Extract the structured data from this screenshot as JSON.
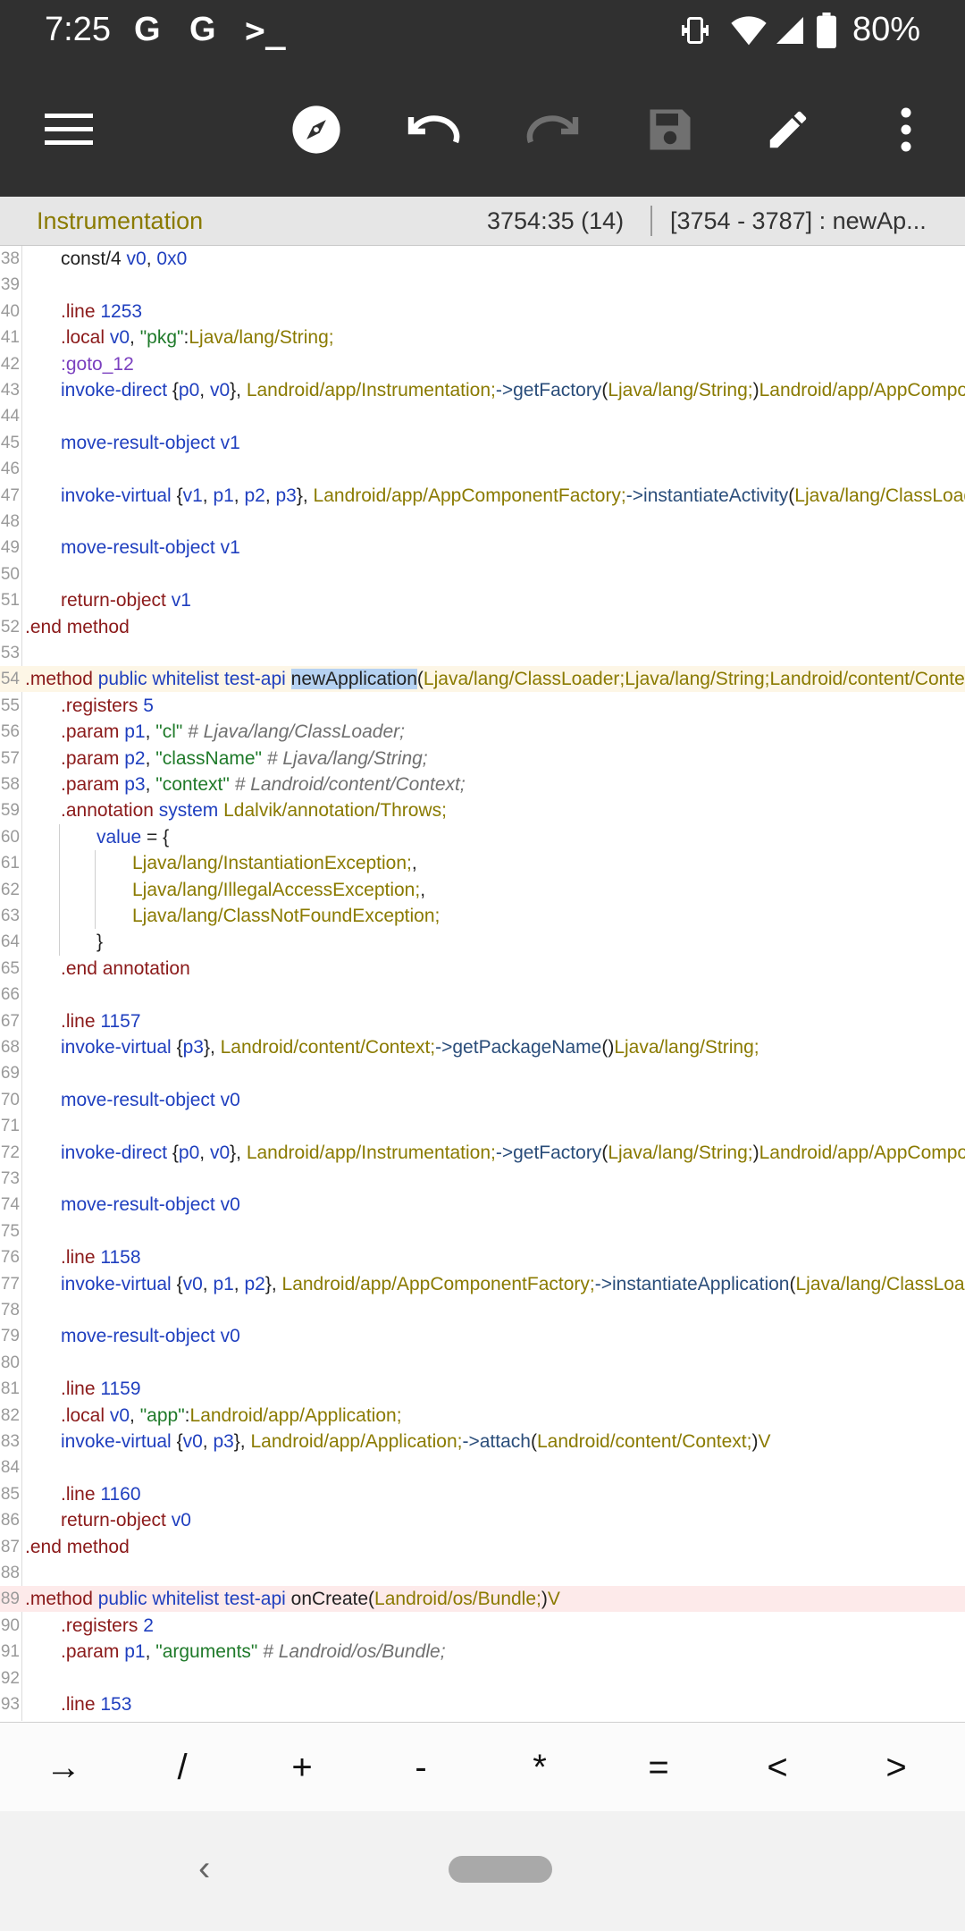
{
  "status_bar": {
    "time": "7:25",
    "notif_icons": [
      "G",
      "G",
      ">_"
    ],
    "battery": "80%"
  },
  "toolbar": {
    "buttons": [
      "menu-icon",
      "compass-icon",
      "undo-icon",
      "redo-icon",
      "save-icon",
      "edit-icon",
      "more-icon"
    ]
  },
  "info_bar": {
    "class_name": "Instrumentation",
    "position": "3754:35 (14)",
    "range": "[3754 - 3787] : newAp..."
  },
  "editor": {
    "lines": [
      {
        "n": "38",
        "tokens": [
          [
            "pl",
            "const/4 "
          ],
          [
            "reg",
            "v0"
          ],
          [
            "pl",
            ", "
          ],
          [
            "reg",
            "0x0"
          ]
        ]
      },
      {
        "n": "39",
        "tokens": []
      },
      {
        "n": "40",
        "tokens": [
          [
            "kw",
            ".line "
          ],
          [
            "reg",
            "1253"
          ]
        ]
      },
      {
        "n": "41",
        "tokens": [
          [
            "kw",
            ".local "
          ],
          [
            "reg",
            "v0"
          ],
          [
            "pl",
            ", "
          ],
          [
            "str",
            "\"pkg\""
          ],
          [
            "pl",
            ":"
          ],
          [
            "cls",
            "Ljava/lang/String;"
          ]
        ]
      },
      {
        "n": "42",
        "tokens": [
          [
            "lbl",
            ":goto_12"
          ]
        ]
      },
      {
        "n": "43",
        "tokens": [
          [
            "reg",
            "invoke-direct "
          ],
          [
            "pl",
            "{"
          ],
          [
            "reg",
            "p0"
          ],
          [
            "pl",
            ", "
          ],
          [
            "reg",
            "v0"
          ],
          [
            "pl",
            "}, "
          ],
          [
            "cls",
            "Landroid/app/Instrumentation;"
          ],
          [
            "meth",
            "->getFactory"
          ],
          [
            "pl",
            "("
          ],
          [
            "cls",
            "Ljava/lang/String;"
          ],
          [
            "pl",
            ")"
          ],
          [
            "cls",
            "Landroid/app/AppComponentFactory;"
          ]
        ]
      },
      {
        "n": "44",
        "tokens": []
      },
      {
        "n": "45",
        "tokens": [
          [
            "reg",
            "move-result-object "
          ],
          [
            "reg",
            "v1"
          ]
        ]
      },
      {
        "n": "46",
        "tokens": []
      },
      {
        "n": "47",
        "tokens": [
          [
            "reg",
            "invoke-virtual "
          ],
          [
            "pl",
            "{"
          ],
          [
            "reg",
            "v1"
          ],
          [
            "pl",
            ", "
          ],
          [
            "reg",
            "p1"
          ],
          [
            "pl",
            ", "
          ],
          [
            "reg",
            "p2"
          ],
          [
            "pl",
            ", "
          ],
          [
            "reg",
            "p3"
          ],
          [
            "pl",
            "}, "
          ],
          [
            "cls",
            "Landroid/app/AppComponentFactory;"
          ],
          [
            "meth",
            "->instantiateActivity"
          ],
          [
            "pl",
            "("
          ],
          [
            "cls",
            "Ljava/lang/ClassLoader;"
          ]
        ]
      },
      {
        "n": "48",
        "tokens": []
      },
      {
        "n": "49",
        "tokens": [
          [
            "reg",
            "move-result-object "
          ],
          [
            "reg",
            "v1"
          ]
        ]
      },
      {
        "n": "50",
        "tokens": []
      },
      {
        "n": "51",
        "tokens": [
          [
            "kw",
            "return-object "
          ],
          [
            "reg",
            "v1"
          ]
        ]
      },
      {
        "n": "52",
        "tokens": [
          [
            "kw",
            ".end method"
          ]
        ]
      },
      {
        "n": "53",
        "tokens": []
      },
      {
        "n": "54",
        "tokens": [
          [
            "kw",
            ".method "
          ],
          [
            "reg",
            "public whitelist test-api "
          ],
          [
            "sel",
            "newApplication"
          ],
          [
            "pl",
            "("
          ],
          [
            "cls",
            "Ljava/lang/ClassLoader;Ljava/lang/String;Landroid/content/Context;"
          ]
        ]
      },
      {
        "n": "55",
        "tokens": [
          [
            "kw",
            ".registers "
          ],
          [
            "reg",
            "5"
          ]
        ]
      },
      {
        "n": "56",
        "tokens": [
          [
            "kw",
            ".param "
          ],
          [
            "reg",
            "p1"
          ],
          [
            "pl",
            ", "
          ],
          [
            "str",
            "\"cl\""
          ],
          [
            "cmt",
            "   # Ljava/lang/ClassLoader;"
          ]
        ]
      },
      {
        "n": "57",
        "tokens": [
          [
            "kw",
            ".param "
          ],
          [
            "reg",
            "p2"
          ],
          [
            "pl",
            ", "
          ],
          [
            "str",
            "\"className\""
          ],
          [
            "cmt",
            "   # Ljava/lang/String;"
          ]
        ]
      },
      {
        "n": "58",
        "tokens": [
          [
            "kw",
            ".param "
          ],
          [
            "reg",
            "p3"
          ],
          [
            "pl",
            ", "
          ],
          [
            "str",
            "\"context\""
          ],
          [
            "cmt",
            "   # Landroid/content/Context;"
          ]
        ]
      },
      {
        "n": "59",
        "tokens": [
          [
            "kw",
            ".annotation "
          ],
          [
            "reg",
            "system "
          ],
          [
            "cls",
            "Ldalvik/annotation/Throws;"
          ]
        ]
      },
      {
        "n": "60",
        "tokens": [
          [
            "reg",
            "value"
          ],
          [
            "pl",
            " = {"
          ]
        ]
      },
      {
        "n": "61",
        "tokens": [
          [
            "cls",
            "Ljava/lang/InstantiationException;"
          ],
          [
            "pl",
            ","
          ]
        ]
      },
      {
        "n": "62",
        "tokens": [
          [
            "cls",
            "Ljava/lang/IllegalAccessException;"
          ],
          [
            "pl",
            ","
          ]
        ]
      },
      {
        "n": "63",
        "tokens": [
          [
            "cls",
            "Ljava/lang/ClassNotFoundException;"
          ]
        ]
      },
      {
        "n": "64",
        "tokens": [
          [
            "pl",
            "}"
          ]
        ]
      },
      {
        "n": "65",
        "tokens": [
          [
            "kw",
            ".end annotation"
          ]
        ]
      },
      {
        "n": "66",
        "tokens": []
      },
      {
        "n": "67",
        "tokens": [
          [
            "kw",
            ".line "
          ],
          [
            "reg",
            "1157"
          ]
        ]
      },
      {
        "n": "68",
        "tokens": [
          [
            "reg",
            "invoke-virtual "
          ],
          [
            "pl",
            "{"
          ],
          [
            "reg",
            "p3"
          ],
          [
            "pl",
            "}, "
          ],
          [
            "cls",
            "Landroid/content/Context;"
          ],
          [
            "meth",
            "->getPackageName"
          ],
          [
            "pl",
            "()"
          ],
          [
            "cls",
            "Ljava/lang/String;"
          ]
        ]
      },
      {
        "n": "69",
        "tokens": []
      },
      {
        "n": "70",
        "tokens": [
          [
            "reg",
            "move-result-object "
          ],
          [
            "reg",
            "v0"
          ]
        ]
      },
      {
        "n": "71",
        "tokens": []
      },
      {
        "n": "72",
        "tokens": [
          [
            "reg",
            "invoke-direct "
          ],
          [
            "pl",
            "{"
          ],
          [
            "reg",
            "p0"
          ],
          [
            "pl",
            ", "
          ],
          [
            "reg",
            "v0"
          ],
          [
            "pl",
            "}, "
          ],
          [
            "cls",
            "Landroid/app/Instrumentation;"
          ],
          [
            "meth",
            "->getFactory"
          ],
          [
            "pl",
            "("
          ],
          [
            "cls",
            "Ljava/lang/String;"
          ],
          [
            "pl",
            ")"
          ],
          [
            "cls",
            "Landroid/app/AppComponentFactory;"
          ]
        ]
      },
      {
        "n": "73",
        "tokens": []
      },
      {
        "n": "74",
        "tokens": [
          [
            "reg",
            "move-result-object "
          ],
          [
            "reg",
            "v0"
          ]
        ]
      },
      {
        "n": "75",
        "tokens": []
      },
      {
        "n": "76",
        "tokens": [
          [
            "kw",
            ".line "
          ],
          [
            "reg",
            "1158"
          ]
        ]
      },
      {
        "n": "77",
        "tokens": [
          [
            "reg",
            "invoke-virtual "
          ],
          [
            "pl",
            "{"
          ],
          [
            "reg",
            "v0"
          ],
          [
            "pl",
            ", "
          ],
          [
            "reg",
            "p1"
          ],
          [
            "pl",
            ", "
          ],
          [
            "reg",
            "p2"
          ],
          [
            "pl",
            "}, "
          ],
          [
            "cls",
            "Landroid/app/AppComponentFactory;"
          ],
          [
            "meth",
            "->instantiateApplication"
          ],
          [
            "pl",
            "("
          ],
          [
            "cls",
            "Ljava/lang/ClassLoader;"
          ]
        ]
      },
      {
        "n": "78",
        "tokens": []
      },
      {
        "n": "79",
        "tokens": [
          [
            "reg",
            "move-result-object "
          ],
          [
            "reg",
            "v0"
          ]
        ]
      },
      {
        "n": "80",
        "tokens": []
      },
      {
        "n": "81",
        "tokens": [
          [
            "kw",
            ".line "
          ],
          [
            "reg",
            "1159"
          ]
        ]
      },
      {
        "n": "82",
        "tokens": [
          [
            "kw",
            ".local "
          ],
          [
            "reg",
            "v0"
          ],
          [
            "pl",
            ", "
          ],
          [
            "str",
            "\"app\""
          ],
          [
            "pl",
            ":"
          ],
          [
            "cls",
            "Landroid/app/Application;"
          ]
        ]
      },
      {
        "n": "83",
        "tokens": [
          [
            "reg",
            "invoke-virtual "
          ],
          [
            "pl",
            "{"
          ],
          [
            "reg",
            "v0"
          ],
          [
            "pl",
            ", "
          ],
          [
            "reg",
            "p3"
          ],
          [
            "pl",
            "}, "
          ],
          [
            "cls",
            "Landroid/app/Application;"
          ],
          [
            "meth",
            "->attach"
          ],
          [
            "pl",
            "("
          ],
          [
            "cls",
            "Landroid/content/Context;"
          ],
          [
            "pl",
            ")"
          ],
          [
            "cls",
            "V"
          ]
        ]
      },
      {
        "n": "84",
        "tokens": []
      },
      {
        "n": "85",
        "tokens": [
          [
            "kw",
            ".line "
          ],
          [
            "reg",
            "1160"
          ]
        ]
      },
      {
        "n": "86",
        "tokens": [
          [
            "kw",
            "return-object "
          ],
          [
            "reg",
            "v0"
          ]
        ]
      },
      {
        "n": "87",
        "tokens": [
          [
            "kw",
            ".end method"
          ]
        ]
      },
      {
        "n": "88",
        "tokens": []
      },
      {
        "n": "89",
        "tokens": [
          [
            "kw",
            ".method "
          ],
          [
            "reg",
            "public whitelist test-api "
          ],
          [
            "pl",
            "onCreate("
          ],
          [
            "cls",
            "Landroid/os/Bundle;"
          ],
          [
            "pl",
            ")"
          ],
          [
            "cls",
            "V"
          ]
        ]
      },
      {
        "n": "90",
        "tokens": [
          [
            "kw",
            ".registers "
          ],
          [
            "reg",
            "2"
          ]
        ]
      },
      {
        "n": "91",
        "tokens": [
          [
            "kw",
            ".param "
          ],
          [
            "reg",
            "p1"
          ],
          [
            "pl",
            ", "
          ],
          [
            "str",
            "\"arguments\""
          ],
          [
            "cmt",
            "   # Landroid/os/Bundle;"
          ]
        ]
      },
      {
        "n": "92",
        "tokens": []
      },
      {
        "n": "93",
        "tokens": [
          [
            "kw",
            ".line "
          ],
          [
            "reg",
            "153"
          ]
        ]
      }
    ]
  },
  "symbol_bar": {
    "keys": [
      "→",
      "/",
      "+",
      "-",
      "*",
      "=",
      "<",
      ">"
    ]
  },
  "nav_bar": {
    "back": "‹"
  }
}
